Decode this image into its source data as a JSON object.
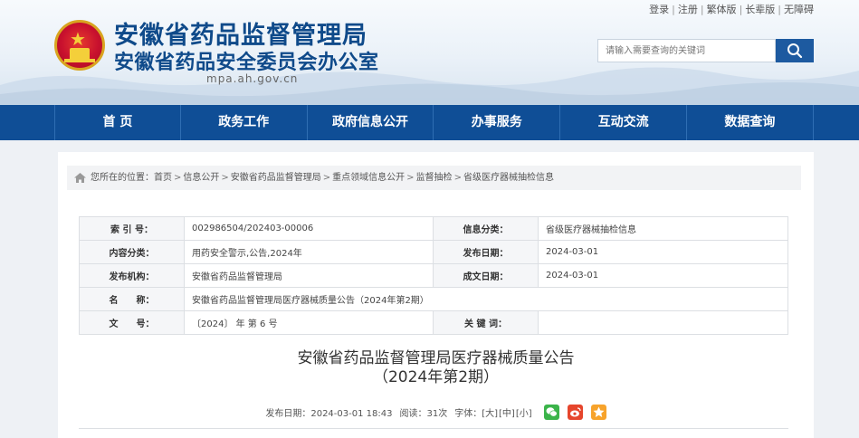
{
  "header": {
    "title_line1": "安徽省药品监督管理局",
    "title_line2": "安徽省药品安全委员会办公室",
    "domain": "mpa.ah.gov.cn",
    "top_links": [
      "登录",
      "注册",
      "繁体版",
      "长辈版",
      "无障碍"
    ],
    "search": {
      "placeholder": "请输入需要查询的关键词"
    }
  },
  "nav": {
    "items": [
      "首 页",
      "政务工作",
      "政府信息公开",
      "办事服务",
      "互动交流",
      "数据查询"
    ]
  },
  "breadcrumb": {
    "prefix": "您所在的位置：",
    "items": [
      "首页",
      "信息公开",
      "安徽省药品监督管理局",
      "重点领域信息公开",
      "监督抽检",
      "省级医疗器械抽检信息"
    ]
  },
  "meta_table": {
    "rows": [
      {
        "l1": "索 引 号：",
        "v1": "002986504/202403-00006",
        "l2": "信息分类：",
        "v2": "省级医疗器械抽检信息"
      },
      {
        "l1": "内容分类：",
        "v1": "用药安全警示,公告,2024年",
        "l2": "发布日期：",
        "v2": "2024-03-01"
      },
      {
        "l1": "发布机构：",
        "v1": "安徽省药品监督管理局",
        "l2": "成文日期：",
        "v2": "2024-03-01"
      },
      {
        "l1": "名　　称：",
        "v1": "安徽省药品监督管理局医疗器械质量公告（2024年第2期）"
      },
      {
        "l1": "文　　号：",
        "v1": "〔2024〕 年 第 6 号",
        "l2": "关 键 词：",
        "v2": ""
      }
    ]
  },
  "article": {
    "title_line1": "安徽省药品监督管理局医疗器械质量公告",
    "title_line2": "（2024年第2期）",
    "publish_label": "发布日期：2024-03-01 18:43",
    "views_label": "阅读：31次",
    "font_label": "字体：",
    "font_sizes": [
      "[大]",
      "[中]",
      "[小]"
    ]
  },
  "colors": {
    "nav": "#0f4e96",
    "title": "#0f4a8a",
    "wechat": "#3bb44a",
    "weibo": "#e6452c",
    "qzone": "#f7a32b"
  }
}
